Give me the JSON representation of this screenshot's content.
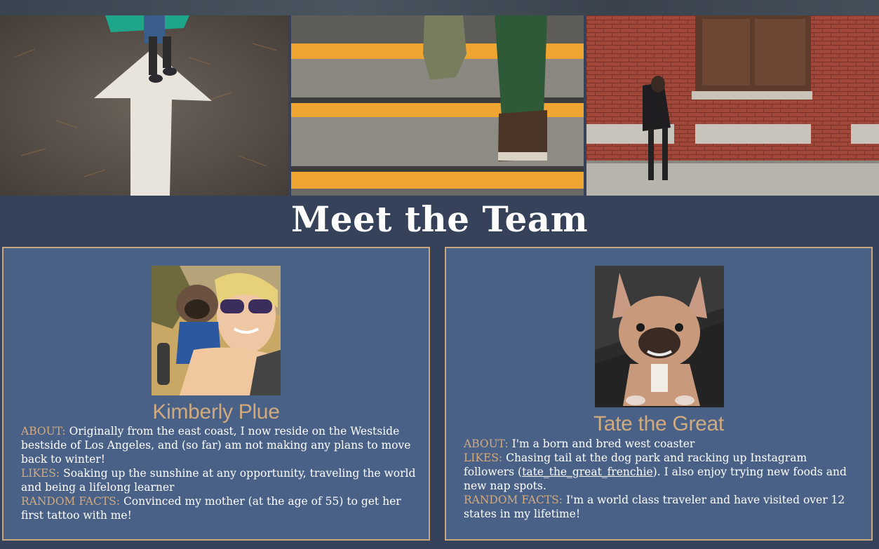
{
  "header": {
    "images": [
      {
        "icon": "arrow-road-photo"
      },
      {
        "icon": "stairs-photo"
      },
      {
        "icon": "brick-wall-walker-photo"
      }
    ]
  },
  "title": "Meet the Team",
  "team": [
    {
      "name": "Kimberly Plue",
      "about_label": "ABOUT:",
      "about": "Originally from the east coast, I now reside on the Westside bestside of Los Angeles, and (so far) am not making any plans to move back to winter!",
      "likes_label": "LIKES:",
      "likes": "Soaking up the sunshine at any opportunity, traveling the world and being a lifelong learner",
      "facts_label": "RANDOM FACTS:",
      "facts": "Convinced my mother (at the age of 55) to get her first tattoo with me!"
    },
    {
      "name": "Tate the Great",
      "about_label": "ABOUT:",
      "about": "I'm a born and bred west coaster",
      "likes_label": "LIKES:",
      "likes_pre": "Chasing tail at the dog park and racking up Instagram followers (",
      "likes_link": "tate_the_great_frenchie",
      "likes_post": "). I also enjoy trying new foods and new nap spots.",
      "facts_label": "RANDOM FACTS:",
      "facts": "I'm a world class traveler and have visited over 12 states in my lifetime!"
    }
  ],
  "colors": {
    "background": "#354259",
    "card": "#4a6187",
    "accent": "#d1aa7e",
    "border": "#c8a67e"
  }
}
